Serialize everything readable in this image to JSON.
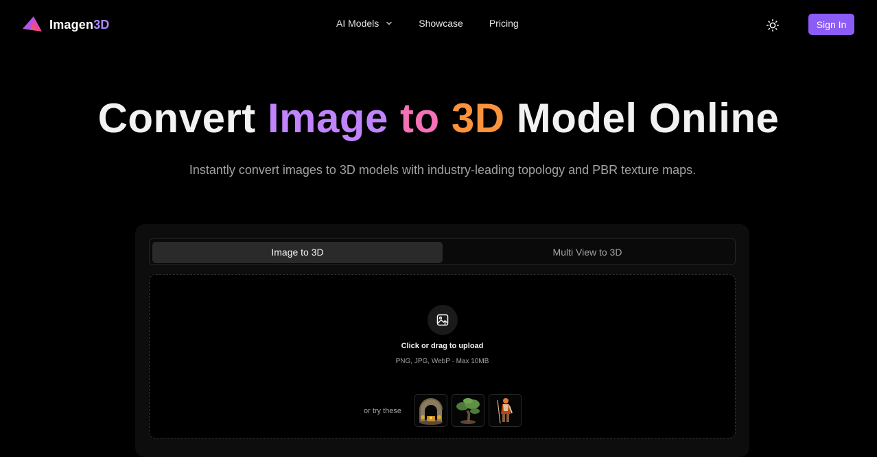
{
  "brand": {
    "name_main": "Imagen",
    "name_accent": "3D"
  },
  "nav": {
    "items": [
      {
        "label": "AI Models",
        "has_dropdown": true
      },
      {
        "label": "Showcase"
      },
      {
        "label": "Pricing"
      }
    ]
  },
  "header": {
    "sign_in_label": "Sign In",
    "theme_icon": "sun-icon"
  },
  "hero": {
    "title_part1": "Convert ",
    "title_word_image": "Image",
    "title_word_to": " to ",
    "title_word_3d": "3D",
    "title_part3": " Model Online",
    "subtitle": "Instantly convert images to 3D models with industry-leading topology and PBR texture maps."
  },
  "converter": {
    "tabs": [
      {
        "label": "Image to 3D",
        "active": true
      },
      {
        "label": "Multi View to 3D",
        "active": false
      }
    ],
    "upload": {
      "icon": "image-upload-icon",
      "title": "Click or drag to upload",
      "hint": "PNG, JPG, WebP · Max 10MB"
    },
    "try_label": "or try these",
    "samples": [
      "stone-archway-thumbnail",
      "bonsai-tree-thumbnail",
      "warrior-figure-thumbnail"
    ]
  },
  "colors": {
    "accent": "#8b5cf6",
    "gradient_purple": "#c084fc",
    "gradient_pink": "#f472b6",
    "gradient_orange": "#fb923c"
  }
}
